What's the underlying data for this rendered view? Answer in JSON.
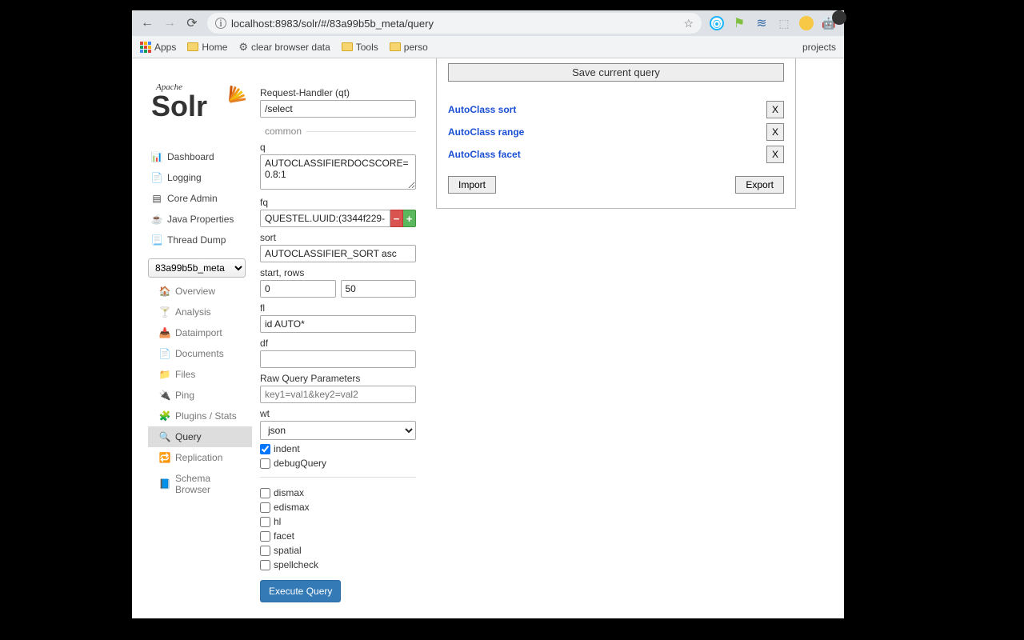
{
  "browser": {
    "url": "localhost:8983/solr/#/83a99b5b_meta/query"
  },
  "bookmarks": {
    "apps": "Apps",
    "items": [
      "Home",
      "clear browser data",
      "Tools",
      "perso",
      "projects"
    ]
  },
  "logo": {
    "apache": "Apache",
    "solr": "Solr"
  },
  "nav": {
    "main": [
      "Dashboard",
      "Logging",
      "Core Admin",
      "Java Properties",
      "Thread Dump"
    ],
    "core": "83a99b5b_meta",
    "sub": [
      "Overview",
      "Analysis",
      "Dataimport",
      "Documents",
      "Files",
      "Ping",
      "Plugins / Stats",
      "Query",
      "Replication",
      "Schema Browser"
    ],
    "active_sub": "Query"
  },
  "form": {
    "qt_label": "Request-Handler (qt)",
    "qt": "/select",
    "legend_common": "common",
    "q_label": "q",
    "q": "AUTOCLASSIFIERDOCSCORE=0.8:1",
    "fq_label": "fq",
    "fq": "QUESTEL.UUID:(3344f229-",
    "sort_label": "sort",
    "sort": "AUTOCLASSIFIER_SORT asc",
    "startrows_label": "start, rows",
    "start": "0",
    "rows": "50",
    "fl_label": "fl",
    "fl": "id AUTO*",
    "df_label": "df",
    "df": "",
    "raw_label": "Raw Query Parameters",
    "raw_placeholder": "key1=val1&key2=val2",
    "wt_label": "wt",
    "wt": "json",
    "indent_label": "indent",
    "debug_label": "debugQuery",
    "dismax": "dismax",
    "edismax": "edismax",
    "hl": "hl",
    "facet": "facet",
    "spatial": "spatial",
    "spellcheck": "spellcheck",
    "exec": "Execute Query"
  },
  "saved": {
    "save": "Save current query",
    "items": [
      "AutoClass sort",
      "AutoClass range",
      "AutoClass facet"
    ],
    "x": "X",
    "import": "Import",
    "export": "Export"
  }
}
